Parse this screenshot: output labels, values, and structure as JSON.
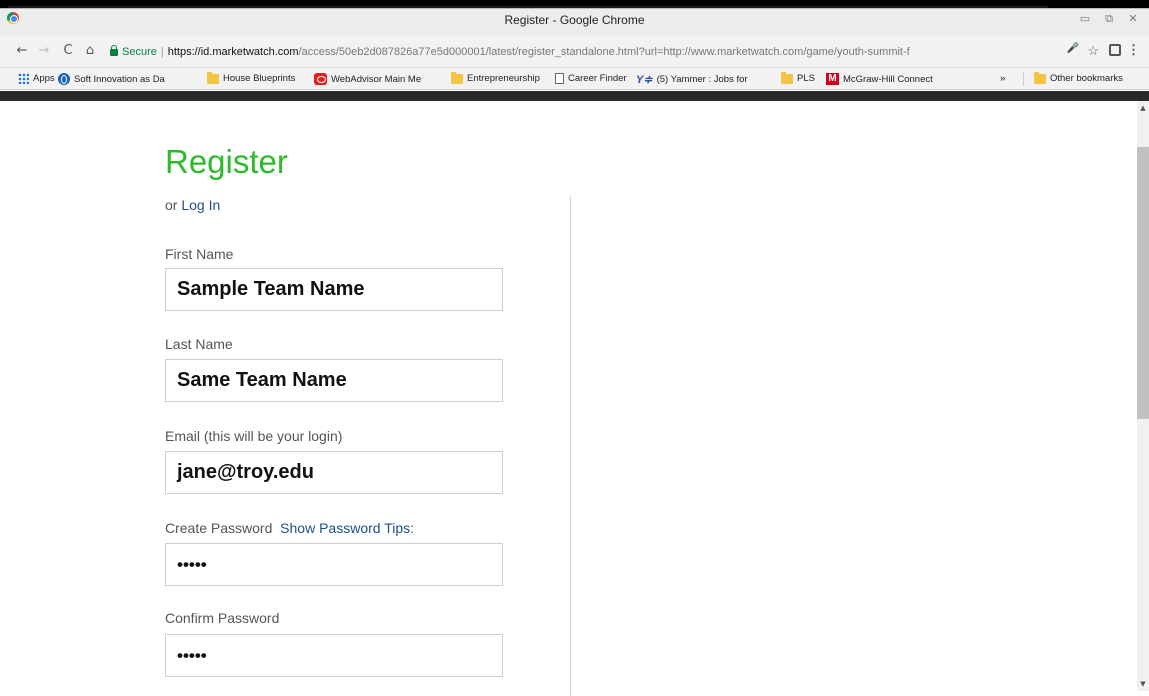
{
  "window": {
    "title": "Register - Google Chrome",
    "minimize_glyph": "▭",
    "maximize_glyph": "⧉",
    "close_glyph": "✕"
  },
  "toolbar": {
    "back_glyph": "←",
    "forward_glyph": "→",
    "reload_glyph": "C",
    "home_glyph": "⌂",
    "secure_label": "Secure",
    "url_host": "https://id.marketwatch.com",
    "url_rest": "/access/50eb2d087826a77e5d000001/latest/register_standalone.html?url=http://www.marketwatch.com/game/youth-summit-f",
    "mic_glyph": "🎤",
    "star_glyph": "☆",
    "menu_glyph": "⋮"
  },
  "bookmarks": {
    "items": [
      {
        "label": "Apps",
        "icon": "apps-grid-icon"
      },
      {
        "label": "Soft Innovation as Da",
        "icon": "globe-icon"
      },
      {
        "label": "House Blueprints",
        "icon": "folder-icon"
      },
      {
        "label": "WebAdvisor Main Me",
        "icon": "red-app-icon"
      },
      {
        "label": "Entrepreneurship",
        "icon": "folder-icon"
      },
      {
        "label": "Career Finder",
        "icon": "page-icon"
      },
      {
        "label": "(5) Yammer : Jobs for",
        "icon": "yammer-icon"
      },
      {
        "label": "PLS",
        "icon": "folder-icon"
      },
      {
        "label": "McGraw-Hill Connect",
        "icon": "mcgraw-hill-icon"
      }
    ],
    "overflow_glyph": "»",
    "other_bookmarks": "Other bookmarks",
    "yammer_glyph": "Y≑",
    "mcgraw_glyph": "M"
  },
  "form": {
    "title": "Register",
    "or_text": "or ",
    "login_link": "Log In",
    "first_name_label": "First Name",
    "first_name_value": "Sample Team Name",
    "last_name_label": "Last Name",
    "last_name_value": "Same Team Name",
    "email_label": "Email (this will be your login)",
    "email_value": "jane@troy.edu",
    "create_password_label": "Create Password",
    "show_password_tips": "Show Password Tips",
    "password_tips_colon": ":",
    "password_value": "•••••",
    "confirm_password_label": "Confirm Password",
    "confirm_password_value": "•••••"
  },
  "scrollbar": {
    "up_glyph": "▲",
    "down_glyph": "▼"
  },
  "colors": {
    "title_green": "#2dbb2d",
    "link_blue": "#1f4f8a",
    "secure_green": "#0b8043"
  }
}
